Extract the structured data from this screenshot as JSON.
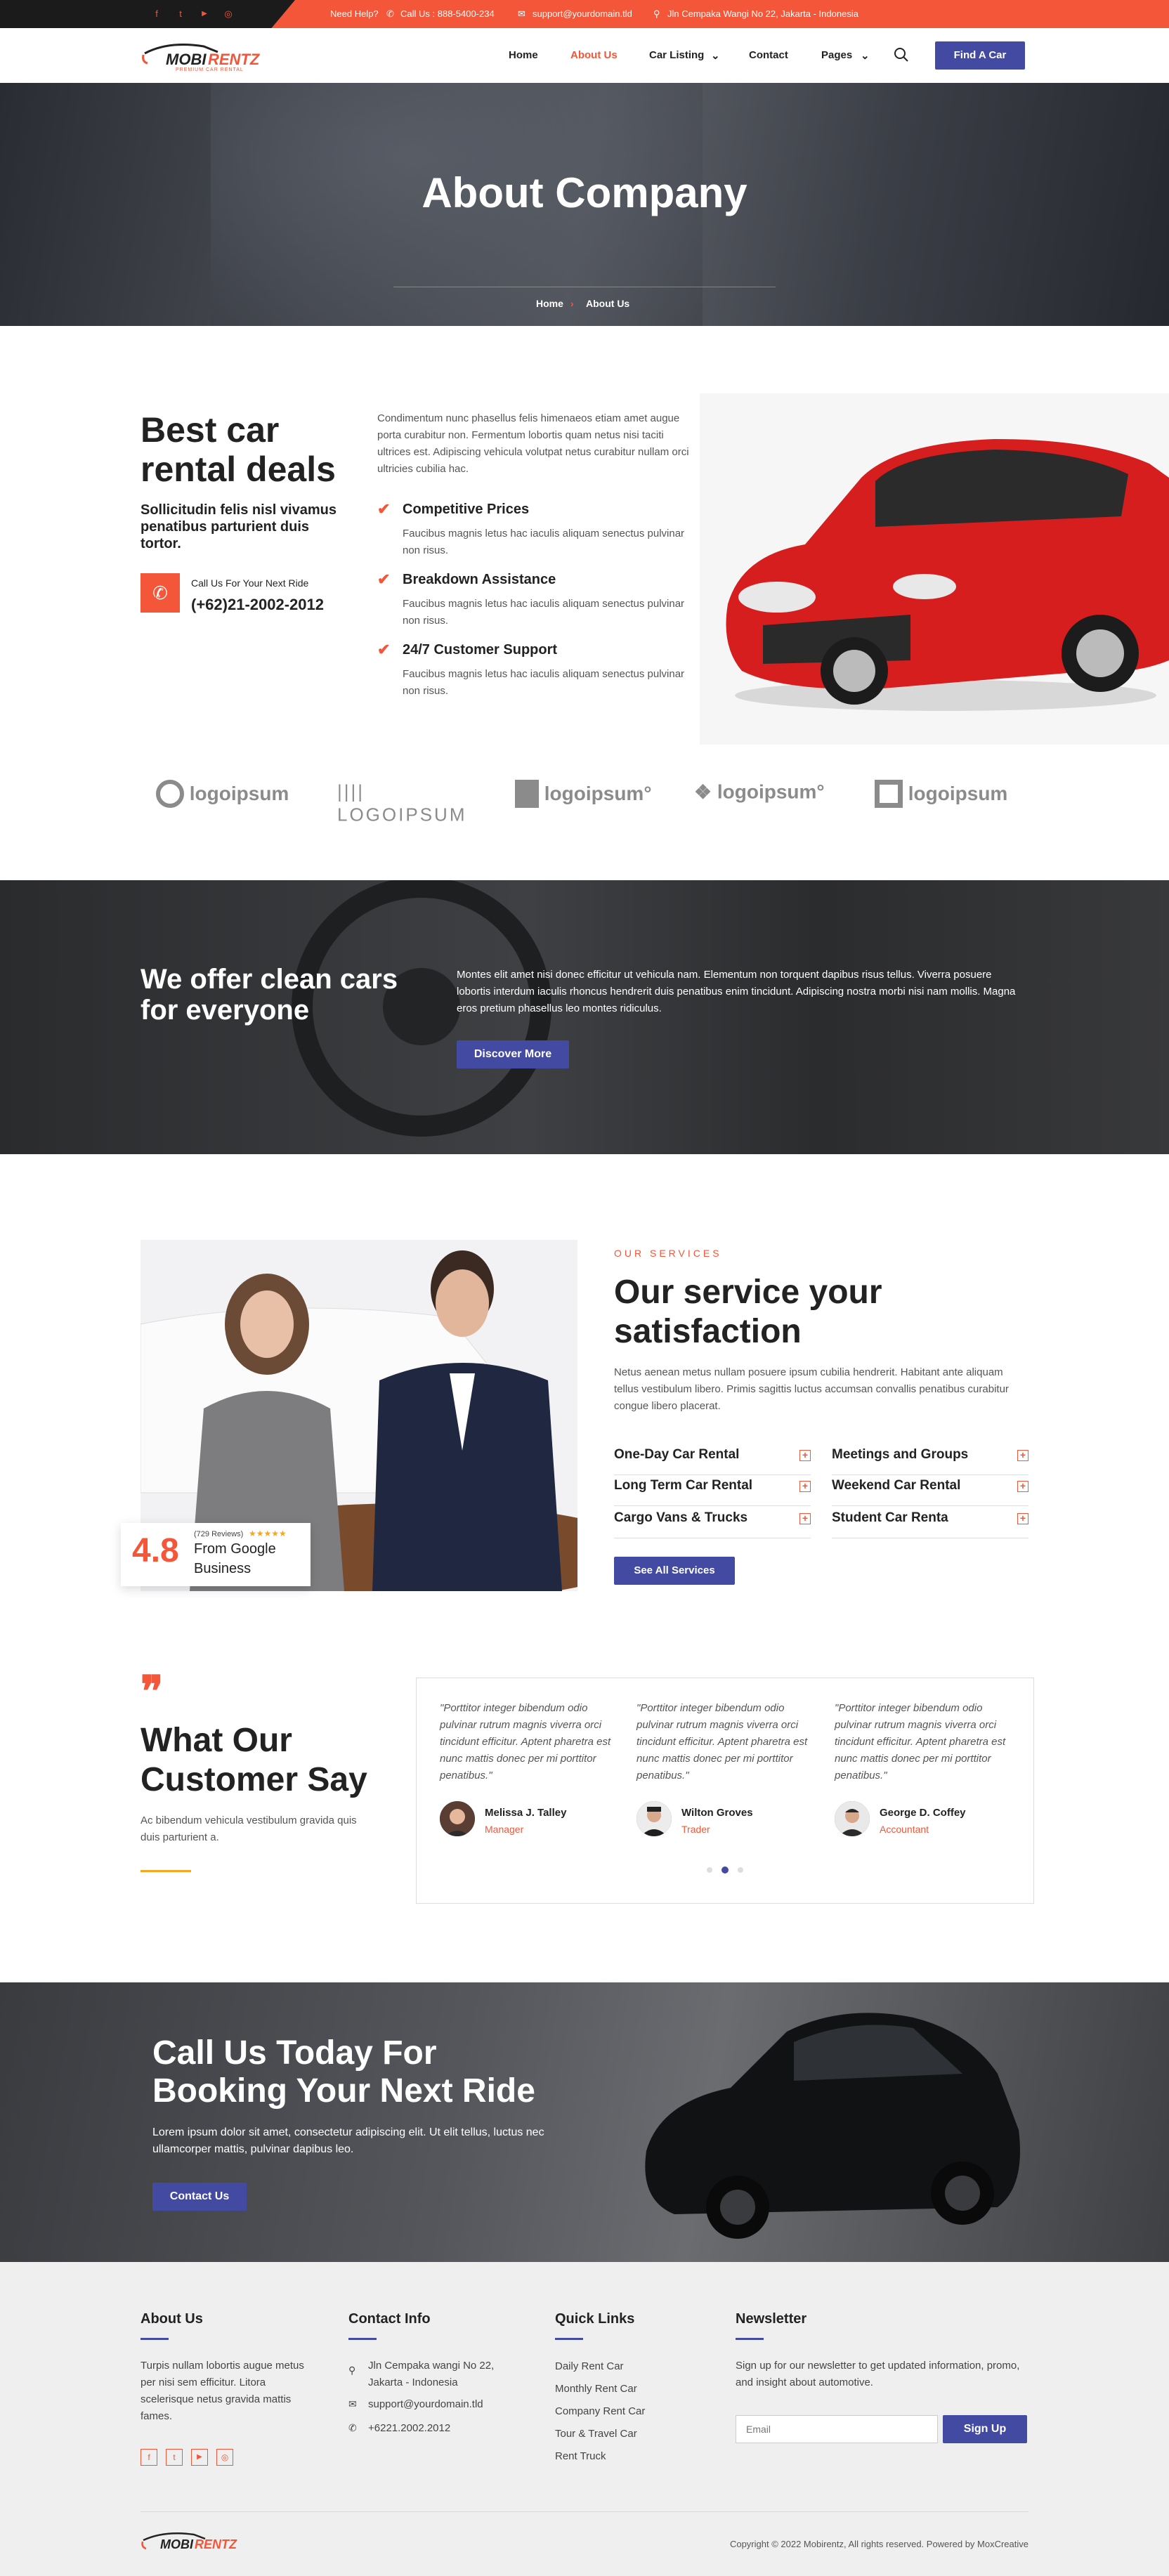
{
  "topbar": {
    "social": [
      "f",
      "t",
      "▶",
      "◎"
    ],
    "help_label": "Need Help?",
    "phone": "Call Us : 888-5400-234",
    "email": "support@yourdomain.tld",
    "address": "Jln Cempaka Wangi No 22, Jakarta - Indonesia"
  },
  "brand": {
    "logo_text_a": "MOBI",
    "logo_text_b": "RENTZ",
    "tagline": "PREMIUM CAR RENTAL"
  },
  "nav": {
    "home": "Home",
    "about": "About Us",
    "cars": "Car Listing",
    "contact": "Contact",
    "pages": "Pages",
    "cta": "Find A Car"
  },
  "hero": {
    "title": "About Company",
    "crumb_home": "Home",
    "crumb_sep": "›",
    "crumb_current": "About Us"
  },
  "about": {
    "title_line1": "Best car",
    "title_line2": "rental deals",
    "subtitle": "Sollicitudin felis nisl vivamus penatibus parturient duis tortor.",
    "call_label": "Call Us For Your Next Ride",
    "call_number": "(+62)21-2002-2012",
    "intro": "Condimentum nunc phasellus felis himenaeos etiam amet augue porta curabitur non. Fermentum lobortis quam netus nisi taciti ultrices est. Adipiscing vehicula volutpat netus curabitur nullam orci ultricies cubilia hac.",
    "features": [
      {
        "title": "Competitive Prices",
        "text": "Faucibus magnis letus hac iaculis aliquam senectus pulvinar non risus."
      },
      {
        "title": "Breakdown Assistance",
        "text": "Faucibus magnis letus hac iaculis aliquam senectus pulvinar non risus."
      },
      {
        "title": "24/7 Customer Support",
        "text": "Faucibus magnis letus hac iaculis aliquam senectus pulvinar non risus."
      }
    ]
  },
  "logos": [
    "logoipsum",
    "LOGOIPSUM",
    "logoipsum°",
    "logoipsum°",
    "logoipsum"
  ],
  "band": {
    "title_line1": "We offer clean cars",
    "title_line2": "for everyone",
    "text": "Montes elit amet nisi donec efficitur ut vehicula nam. Elementum non torquent dapibus risus tellus. Viverra posuere lobortis interdum iaculis rhoncus hendrerit duis penatibus enim tincidunt. Adipiscing nostra morbi nisi nam mollis. Magna eros pretium phasellus leo montes ridiculus.",
    "button": "Discover More"
  },
  "services": {
    "eyebrow": "OUR SERVICES",
    "title_line1": "Our service your",
    "title_line2": "satisfaction",
    "text": "Netus aenean metus nullam posuere ipsum cubilia hendrerit. Habitant ante aliquam tellus vestibulum libero. Primis sagittis luctus accumsan convallis penatibus curabitur congue libero placerat.",
    "items": [
      "One-Day Car Rental",
      "Meetings and Groups",
      "Long Term Car Rental",
      "Weekend Car Rental",
      "Cargo Vans & Trucks",
      "Student Car Renta"
    ],
    "button": "See All Services",
    "rating": {
      "score": "4.8",
      "reviews": "(729 Reviews)",
      "stars": "★★★★★",
      "line1": "From Google",
      "line2": "Business"
    }
  },
  "testimonials": {
    "quote_mark": "❞",
    "title_line1": "What Our",
    "title_line2": "Customer Say",
    "text": "Ac bibendum vehicula vestibulum gravida quis duis parturient a.",
    "items": [
      {
        "quote": "\"Porttitor integer bibendum odio pulvinar rutrum magnis viverra orci tincidunt efficitur. Aptent pharetra est nunc mattis donec per mi porttitor penatibus.\"",
        "name": "Melissa J. Talley",
        "role": "Manager"
      },
      {
        "quote": "\"Porttitor integer bibendum odio pulvinar rutrum magnis viverra orci tincidunt efficitur. Aptent pharetra est nunc mattis donec per mi porttitor penatibus.\"",
        "name": "Wilton Groves",
        "role": "Trader"
      },
      {
        "quote": "\"Porttitor integer bibendum odio pulvinar rutrum magnis viverra orci tincidunt efficitur. Aptent pharetra est nunc mattis donec per mi porttitor penatibus.\"",
        "name": "George D. Coffey",
        "role": "Accountant"
      }
    ]
  },
  "cta": {
    "title_line1": "Call Us Today For",
    "title_line2": "Booking Your Next Ride",
    "text": "Lorem ipsum dolor sit amet, consectetur adipiscing elit. Ut elit tellus, luctus nec ullamcorper mattis, pulvinar dapibus leo.",
    "button": "Contact Us"
  },
  "footer": {
    "about_title": "About Us",
    "about_text": "Turpis nullam lobortis augue metus per nisi sem efficitur. Litora scelerisque netus gravida mattis fames.",
    "contact_title": "Contact Info",
    "contact_address": "Jln Cempaka wangi No 22, Jakarta - Indonesia",
    "contact_email": "support@yourdomain.tld",
    "contact_phone": "+6221.2002.2012",
    "links_title": "Quick Links",
    "links": [
      "Daily Rent Car",
      "Monthly Rent Car",
      "Company Rent Car",
      "Tour & Travel Car",
      "Rent Truck"
    ],
    "newsletter_title": "Newsletter",
    "newsletter_text": "Sign up for our newsletter to get updated information, promo, and insight about automotive.",
    "email_placeholder": "Email",
    "signup": "Sign Up",
    "copyright": "Copyright © 2022 Mobirentz, All rights reserved. Powered by MoxCreative"
  },
  "colors": {
    "accent": "#f35638",
    "primary": "#424aa2",
    "dark": "#1b1b1b"
  }
}
